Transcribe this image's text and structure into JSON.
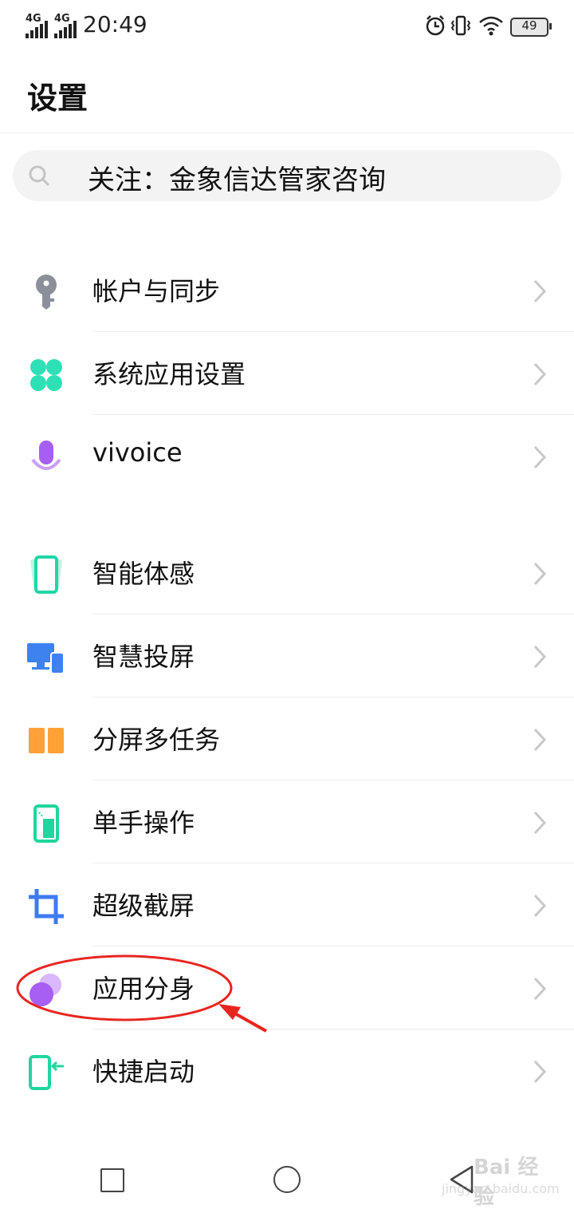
{
  "status_bar": {
    "network_1": "4G",
    "network_2": "4G",
    "time": "20:49",
    "battery": "49",
    "icons": [
      "alarm-icon",
      "vibrate-icon",
      "wifi-icon",
      "battery-icon"
    ]
  },
  "page_title": "设置",
  "search": {
    "icon": "search-icon",
    "text": "关注：金象信达管家咨询"
  },
  "items": [
    {
      "label": "帐户与同步",
      "icon": "key-icon",
      "color": "#8a8f99"
    },
    {
      "label": "系统应用设置",
      "icon": "clover-icon",
      "color": "#2ee0b6"
    },
    {
      "label": "vivoice",
      "icon": "microphone-icon",
      "color": "#a75ef2"
    },
    {
      "label": "智能体感",
      "icon": "phone-motion-icon",
      "color": "#21d6a7"
    },
    {
      "label": "智慧投屏",
      "icon": "screen-cast-icon",
      "color": "#3e82f0"
    },
    {
      "label": "分屏多任务",
      "icon": "split-screen-icon",
      "color": "#ffa136"
    },
    {
      "label": "单手操作",
      "icon": "one-hand-icon",
      "color": "#1fd69e"
    },
    {
      "label": "超级截屏",
      "icon": "crop-icon",
      "color": "#3e7bf0"
    },
    {
      "label": "应用分身",
      "icon": "app-clone-icon",
      "color": "#a75ef2"
    },
    {
      "label": "快捷启动",
      "icon": "quick-launch-icon",
      "color": "#1fd6a0"
    }
  ],
  "annotation": {
    "color": "#e8251f"
  },
  "nav_bar": {
    "buttons": [
      "recent-apps-button",
      "home-button",
      "back-button"
    ]
  },
  "watermark": {
    "line1": "Bai 经验",
    "line2": "jingyan.baidu.com"
  }
}
